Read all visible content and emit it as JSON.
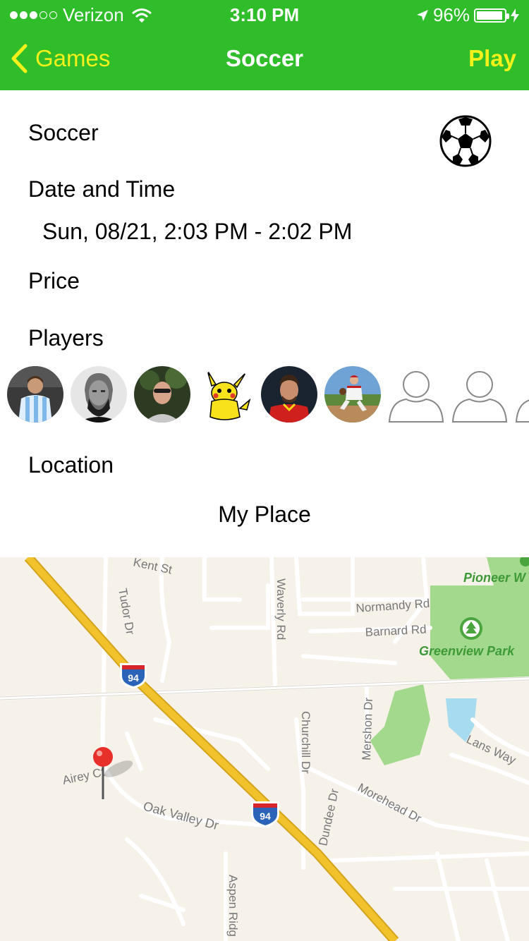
{
  "status_bar": {
    "carrier": "Verizon",
    "time": "3:10 PM",
    "battery": "96%",
    "battery_level": 0.96,
    "icons": [
      "signal-dots",
      "wifi-icon",
      "location-arrow-icon",
      "battery-icon",
      "charging-bolt-icon"
    ]
  },
  "nav": {
    "back_label": "Games",
    "title": "Soccer",
    "action_label": "Play"
  },
  "colors": {
    "nav_bg": "#2fbd2a",
    "nav_button": "#f4f01a",
    "pin": "#e8302a",
    "highway": "#f2c22c",
    "park": "#9fd88a",
    "water": "#a7dbef"
  },
  "game": {
    "name": "Soccer",
    "sport_icon": "soccer-ball-icon",
    "date_label": "Date and Time",
    "date_value": "Sun, 08/21, 2:03 PM - 2:02 PM",
    "price_label": "Price",
    "players_label": "Players",
    "location_label": "Location",
    "location_value": "My Place"
  },
  "players": [
    {
      "name": "player-1",
      "type": "photo"
    },
    {
      "name": "player-2",
      "type": "photo"
    },
    {
      "name": "player-3",
      "type": "photo"
    },
    {
      "name": "player-4",
      "type": "photo"
    },
    {
      "name": "player-5",
      "type": "photo"
    },
    {
      "name": "player-6",
      "type": "photo"
    },
    {
      "name": "empty-slot-1",
      "type": "empty"
    },
    {
      "name": "empty-slot-2",
      "type": "empty"
    },
    {
      "name": "empty-slot-3",
      "type": "empty"
    }
  ],
  "map": {
    "streets": [
      "Kent St",
      "Tudor Dr",
      "Waverly Rd",
      "Normandy Rd",
      "Barnard Rd",
      "Churchill Dr",
      "Mershon Dr",
      "Airey Ct",
      "Oak Valley Dr",
      "Dundee Dr",
      "Morehead Dr",
      "Lans Way",
      "Aspen Ridg"
    ],
    "parks": [
      "Pioneer W",
      "Greenview Park"
    ],
    "highway_shield": "94"
  }
}
